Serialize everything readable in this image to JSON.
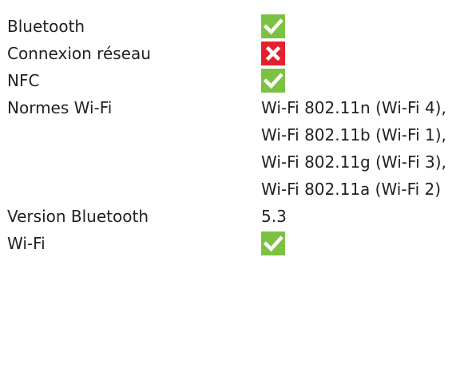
{
  "specs": [
    {
      "label": "Bluetooth",
      "icon": "checkmark-icon",
      "status": "yes"
    },
    {
      "label": "Connexion réseau",
      "icon": "cross-icon",
      "status": "no"
    },
    {
      "label": "NFC",
      "icon": "checkmark-icon",
      "status": "yes"
    },
    {
      "label": "Normes Wi-Fi",
      "value": "Wi-Fi 802.11n (Wi-Fi 4), Wi-Fi 802.11b (Wi-Fi 1), Wi-Fi 802.11g (Wi-Fi 3), Wi-Fi 802.11a (Wi-Fi 2)"
    },
    {
      "label": "Version Bluetooth",
      "value": "5.3"
    },
    {
      "label": "Wi-Fi",
      "icon": "checkmark-icon",
      "status": "yes"
    }
  ],
  "colors": {
    "yes": "#7cc242",
    "no": "#e5202e",
    "text": "#222222"
  }
}
